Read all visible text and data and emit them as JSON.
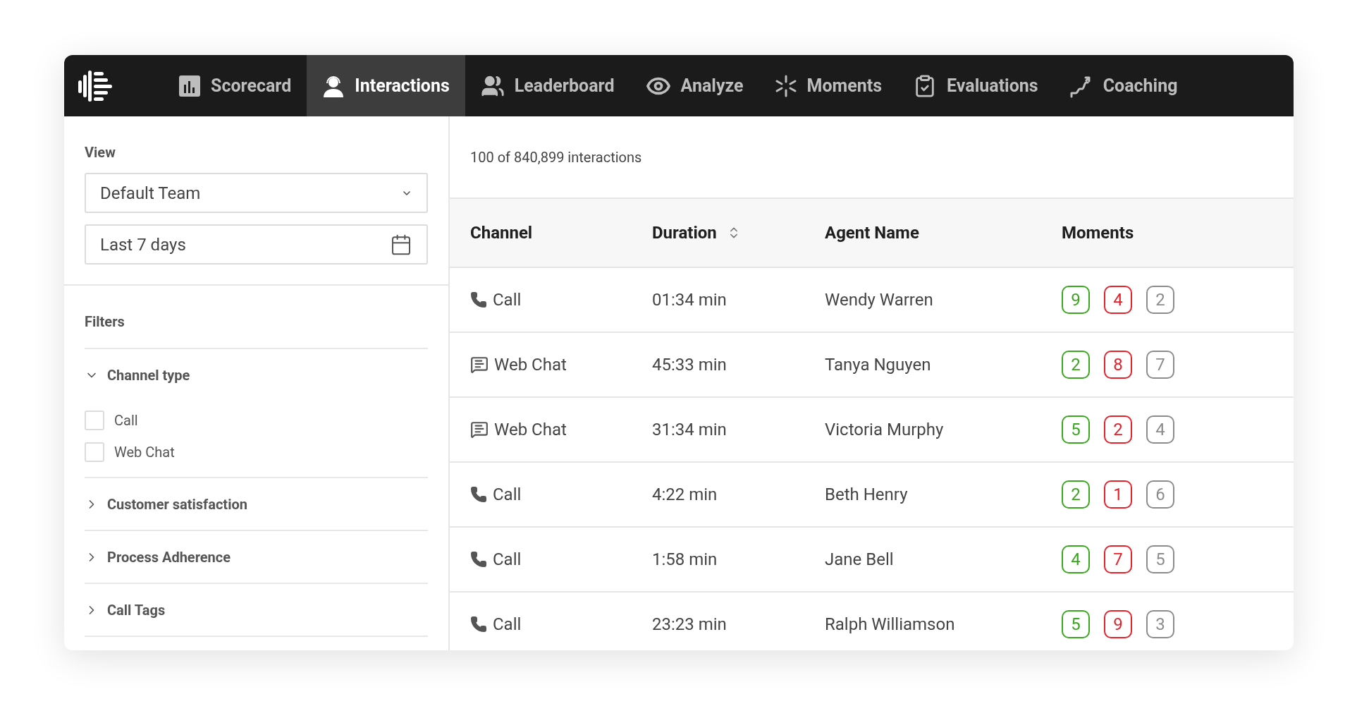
{
  "nav": {
    "items": [
      {
        "label": "Scorecard",
        "kind": "scorecard",
        "selected": false
      },
      {
        "label": "Interactions",
        "kind": "agent",
        "selected": true
      },
      {
        "label": "Leaderboard",
        "kind": "people",
        "selected": false
      },
      {
        "label": "Analyze",
        "kind": "eye",
        "selected": false
      },
      {
        "label": "Moments",
        "kind": "burst",
        "selected": false
      },
      {
        "label": "Evaluations",
        "kind": "clipboard",
        "selected": false
      },
      {
        "label": "Coaching",
        "kind": "steps",
        "selected": false
      }
    ]
  },
  "sidebar": {
    "view_label": "View",
    "team_select": {
      "value": "Default Team"
    },
    "date_field": {
      "value": "Last 7 days"
    },
    "filters_label": "Filters",
    "filter_groups": [
      {
        "label": "Channel type",
        "expanded": true,
        "options": [
          {
            "label": "Call",
            "checked": false
          },
          {
            "label": "Web Chat",
            "checked": false
          }
        ]
      },
      {
        "label": "Customer satisfaction",
        "expanded": false
      },
      {
        "label": "Process Adherence",
        "expanded": false
      },
      {
        "label": "Call Tags",
        "expanded": false
      }
    ]
  },
  "table": {
    "count": "100 of 840,899 interactions",
    "columns": [
      {
        "label": "Channel",
        "sortable": false
      },
      {
        "label": "Duration",
        "sortable": true
      },
      {
        "label": "Agent Name",
        "sortable": false
      },
      {
        "label": "Moments",
        "sortable": false
      }
    ],
    "rows": [
      {
        "channel": "Call",
        "kind": "call",
        "duration": "01:34 min",
        "agent": "Wendy Warren",
        "moments": [
          {
            "value": "9",
            "color": "#3aa81e"
          },
          {
            "value": "4",
            "color": "#e8202a"
          },
          {
            "value": "2",
            "color": "#8c8c8c"
          }
        ]
      },
      {
        "channel": "Web Chat",
        "kind": "chat",
        "duration": "45:33 min",
        "agent": "Tanya Nguyen",
        "moments": [
          {
            "value": "2",
            "color": "#3aa81e"
          },
          {
            "value": "8",
            "color": "#e8202a"
          },
          {
            "value": "7",
            "color": "#8c8c8c"
          }
        ]
      },
      {
        "channel": "Web Chat",
        "kind": "chat",
        "duration": "31:34 min",
        "agent": "Victoria Murphy",
        "moments": [
          {
            "value": "5",
            "color": "#3aa81e"
          },
          {
            "value": "2",
            "color": "#e8202a"
          },
          {
            "value": "4",
            "color": "#8c8c8c"
          }
        ]
      },
      {
        "channel": "Call",
        "kind": "call",
        "duration": "4:22 min",
        "agent": "Beth Henry",
        "moments": [
          {
            "value": "2",
            "color": "#3aa81e"
          },
          {
            "value": "1",
            "color": "#e8202a"
          },
          {
            "value": "6",
            "color": "#8c8c8c"
          }
        ]
      },
      {
        "channel": "Call",
        "kind": "call",
        "duration": "1:58 min",
        "agent": "Jane Bell",
        "moments": [
          {
            "value": "4",
            "color": "#3aa81e"
          },
          {
            "value": "7",
            "color": "#e8202a"
          },
          {
            "value": "5",
            "color": "#8c8c8c"
          }
        ]
      },
      {
        "channel": "Call",
        "kind": "call",
        "duration": "23:23 min",
        "agent": "Ralph Williamson",
        "moments": [
          {
            "value": "5",
            "color": "#3aa81e"
          },
          {
            "value": "9",
            "color": "#e8202a"
          },
          {
            "value": "3",
            "color": "#8c8c8c"
          }
        ]
      }
    ]
  }
}
